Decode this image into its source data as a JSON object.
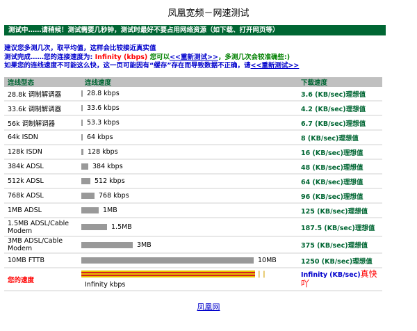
{
  "page": {
    "title": "凤凰宽频－网速测试",
    "banner": "测试中……请稍候！测试需要几秒钟，测试时最好不要占用网络资源（如下载、打开网页等）",
    "info": {
      "line1": "建议您多测几次，取平均值，这样会比较接近真实值",
      "line2_prefix": "测试完成……您的连接速度为: ",
      "line2_speed": "Infinity (kbps)",
      "line2_mid": " 您可以",
      "line2_link": "<<重新测试>>",
      "line2_suffix": "，多测几次会较准确些:)",
      "line3_prefix": "如果您的连线速度不可能这么快，这一页可能因有“缓存”存在而导致数据不正确，请",
      "line3_link": "<<重新测试>>"
    },
    "footer_link": "凤凰网"
  },
  "table": {
    "headers": {
      "type": "连线型态",
      "speed": "连线速度",
      "download": "下载速度"
    },
    "rows": [
      {
        "type": "28.8k 调制解调器",
        "speed": "28.8 kbps",
        "level": 0.0029,
        "download": "3.6 (KB/sec)理想值"
      },
      {
        "type": "33.6k 调制解调器",
        "speed": "33.6 kbps",
        "level": 0.0034,
        "download": "4.2 (KB/sec)理想值"
      },
      {
        "type": "56k 调制解调器",
        "speed": "53.3 kbps",
        "level": 0.0053,
        "download": "6.7 (KB/sec)理想值"
      },
      {
        "type": "64k ISDN",
        "speed": "64 kbps",
        "level": 0.0064,
        "download": "8 (KB/sec)理想值"
      },
      {
        "type": "128k ISDN",
        "speed": "128 kbps",
        "level": 0.0128,
        "download": "16 (KB/sec)理想值"
      },
      {
        "type": "384k ADSL",
        "speed": "384 kbps",
        "level": 0.0384,
        "download": "48 (KB/sec)理想值"
      },
      {
        "type": "512k ADSL",
        "speed": "512 kbps",
        "level": 0.0512,
        "download": "64 (KB/sec)理想值"
      },
      {
        "type": "768k ADSL",
        "speed": "768 kbps",
        "level": 0.0768,
        "download": "96 (KB/sec)理想值"
      },
      {
        "type": "1MB ADSL",
        "speed": "1MB",
        "level": 0.1,
        "download": "125 (KB/sec)理想值"
      },
      {
        "type": "1.5MB ADSL/Cable Modem",
        "speed": "1.5MB",
        "level": 0.15,
        "download": "187.5 (KB/sec)理想值"
      },
      {
        "type": "3MB ADSL/Cable Modem",
        "speed": "3MB",
        "level": 0.3,
        "download": "375 (KB/sec)理想值"
      },
      {
        "type": "10MB FTTB",
        "speed": "10MB",
        "level": 1.0,
        "download": "1250 (KB/sec)理想值"
      }
    ],
    "your_row": {
      "type": "您的速度",
      "speed": "Infinity kbps",
      "ticks": "| |",
      "download_value": "Infinity",
      "download_unit": "(KB/sec)",
      "download_note": "真快吖"
    }
  },
  "colors": {
    "banner_bg": "#006633",
    "header_bg": "#c0c0c0",
    "bar": "#999999",
    "rate_text": "#006633",
    "accent_red": "#ff0000",
    "link_blue": "#0000cc"
  }
}
